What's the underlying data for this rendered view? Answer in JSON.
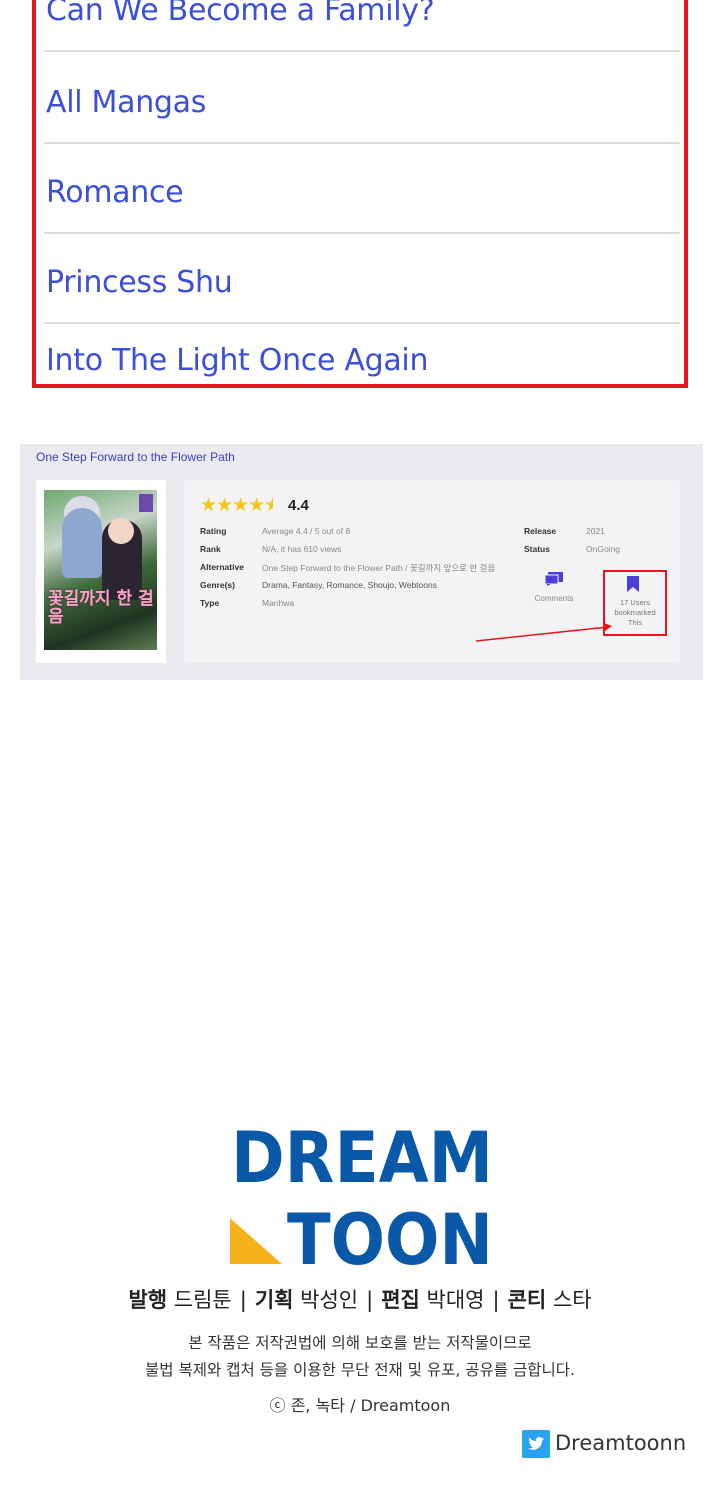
{
  "menu": {
    "items": [
      {
        "label": "Can We Become a Family?"
      },
      {
        "label": "All Mangas"
      },
      {
        "label": "Romance"
      },
      {
        "label": "Princess Shu"
      },
      {
        "label": "Into The Light Once Again"
      }
    ]
  },
  "manga": {
    "title": "One Step Forward to the Flower Path",
    "cover_text": "꽃길까지 한 걸음",
    "rating_value": "4.4",
    "stars_filled": 4.4,
    "info": {
      "rating_label": "Rating",
      "rating_value": "Average 4.4 / 5 out of 8",
      "rank_label": "Rank",
      "rank_value": "N/A, it has 610 views",
      "alternative_label": "Alternative",
      "alternative_value": "One Step Forward to the Flower Path / 꽃길까지 앞으로 한 걸음",
      "genres_label": "Genre(s)",
      "genres_value": "Drama,  Fantasy,  Romance,  Shoujo,  Webtoons",
      "type_label": "Type",
      "type_value": "Manhwa",
      "release_label": "Release",
      "release_value": "2021",
      "status_label": "Status",
      "status_value": "OnGoing"
    },
    "comments_label": "Comments",
    "bookmark_text": [
      "17 Users",
      "bookmarked",
      "This"
    ]
  },
  "colors": {
    "link": "#3b4fd8",
    "highlight": "#e8141c",
    "star": "#f5c518",
    "brand_blue": "#0a58a8",
    "brand_yellow": "#f6b21b"
  },
  "footer": {
    "logo_line1": "DREAM",
    "logo_line2": "TOON",
    "credits": [
      {
        "role": "발행",
        "name": "드림툰"
      },
      {
        "role": "기획",
        "name": "박성인"
      },
      {
        "role": "편집",
        "name": "박대영"
      },
      {
        "role": "콘티",
        "name": "스타"
      }
    ],
    "notice_line1": "본 작품은 저작권법에 의해 보호를 받는 저작물이므로",
    "notice_line2": "불법 복제와 캡처 등을 이용한 무단 전재 및 유포, 공유를 금합니다.",
    "copyright": "ⓒ 존, 녹타 / Dreamtoon",
    "twitter_handle": "Dreamtoonn",
    "twitter_icon": "twitter-icon"
  }
}
